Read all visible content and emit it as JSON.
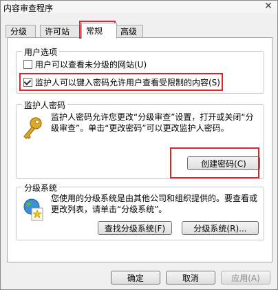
{
  "window": {
    "title": "内容审查程序",
    "close_glyph": "✕"
  },
  "tabs": [
    {
      "label": "分级"
    },
    {
      "label": "许可站点"
    },
    {
      "label": "常规"
    },
    {
      "label": "高级"
    }
  ],
  "user_options": {
    "title": "用户选项",
    "option1": {
      "label": "用户可以查看未分级的网站(U)",
      "checked": false
    },
    "option2": {
      "label": "监护人可以键入密码允许用户查看受限制的内容(S)",
      "checked": true
    }
  },
  "supervisor_password": {
    "title": "监护人密码",
    "description": "监护人密码允许您更改“分级审查”设置，打开或关闭“分级审查”。单击“更改密码”可以更改监护人密码。",
    "icon": "key-icon",
    "create_button": "创建密码(C)"
  },
  "rating_systems": {
    "title": "分级系统",
    "description": "您使用的分级系统是由其他公司和组织提供的。要查看或更改列表，请单击“分级系统”。",
    "icon": "globe-certificate-icon",
    "find_button": "查找分级系统(F)",
    "systems_button": "分级系统(R)..."
  },
  "footer": {
    "ok": "确定",
    "cancel": "取消",
    "apply": "应用(A)"
  },
  "colors": {
    "highlight": "#d8262e",
    "key": "#e0a92a"
  }
}
